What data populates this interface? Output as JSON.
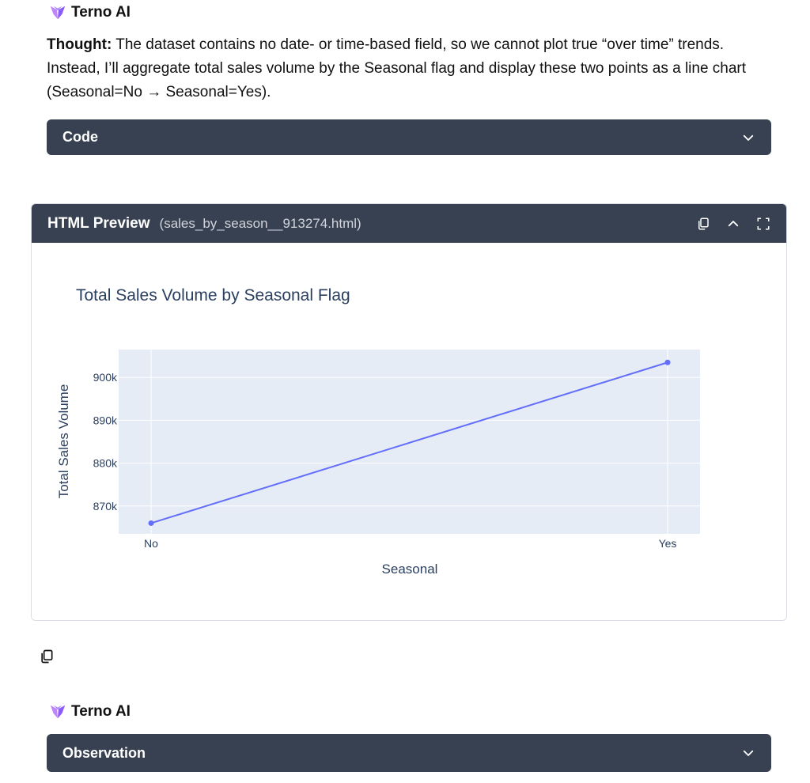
{
  "agent": {
    "name": "Terno AI"
  },
  "thought": {
    "label": "Thought:",
    "text": "The dataset contains no date- or time-based field, so we cannot plot true “over time” trends. Instead, I’ll aggregate total sales volume by the Seasonal flag and display these two points as a line chart (Seasonal=No → Seasonal=Yes)."
  },
  "code_section": {
    "label": "Code"
  },
  "preview": {
    "title": "HTML Preview",
    "filename": "(sales_by_season__913274.html)"
  },
  "observation": {
    "label": "Observation"
  },
  "colors": {
    "dark_bar": "#374151",
    "line": "#636efa",
    "plot_bg": "#e5ecf6",
    "logo_purple": "#9b5cf6"
  },
  "chart_data": {
    "type": "line",
    "title": "Total Sales Volume by Seasonal Flag",
    "xlabel": "Seasonal",
    "ylabel": "Total Sales Volume",
    "categories": [
      "No",
      "Yes"
    ],
    "series": [
      {
        "values": [
          866000,
          903500
        ]
      }
    ],
    "yticks": [
      870000,
      880000,
      890000,
      900000
    ],
    "ytick_labels": [
      "870k",
      "880k",
      "890k",
      "900k"
    ],
    "ylim": [
      863500,
      906500
    ],
    "grid": true
  }
}
